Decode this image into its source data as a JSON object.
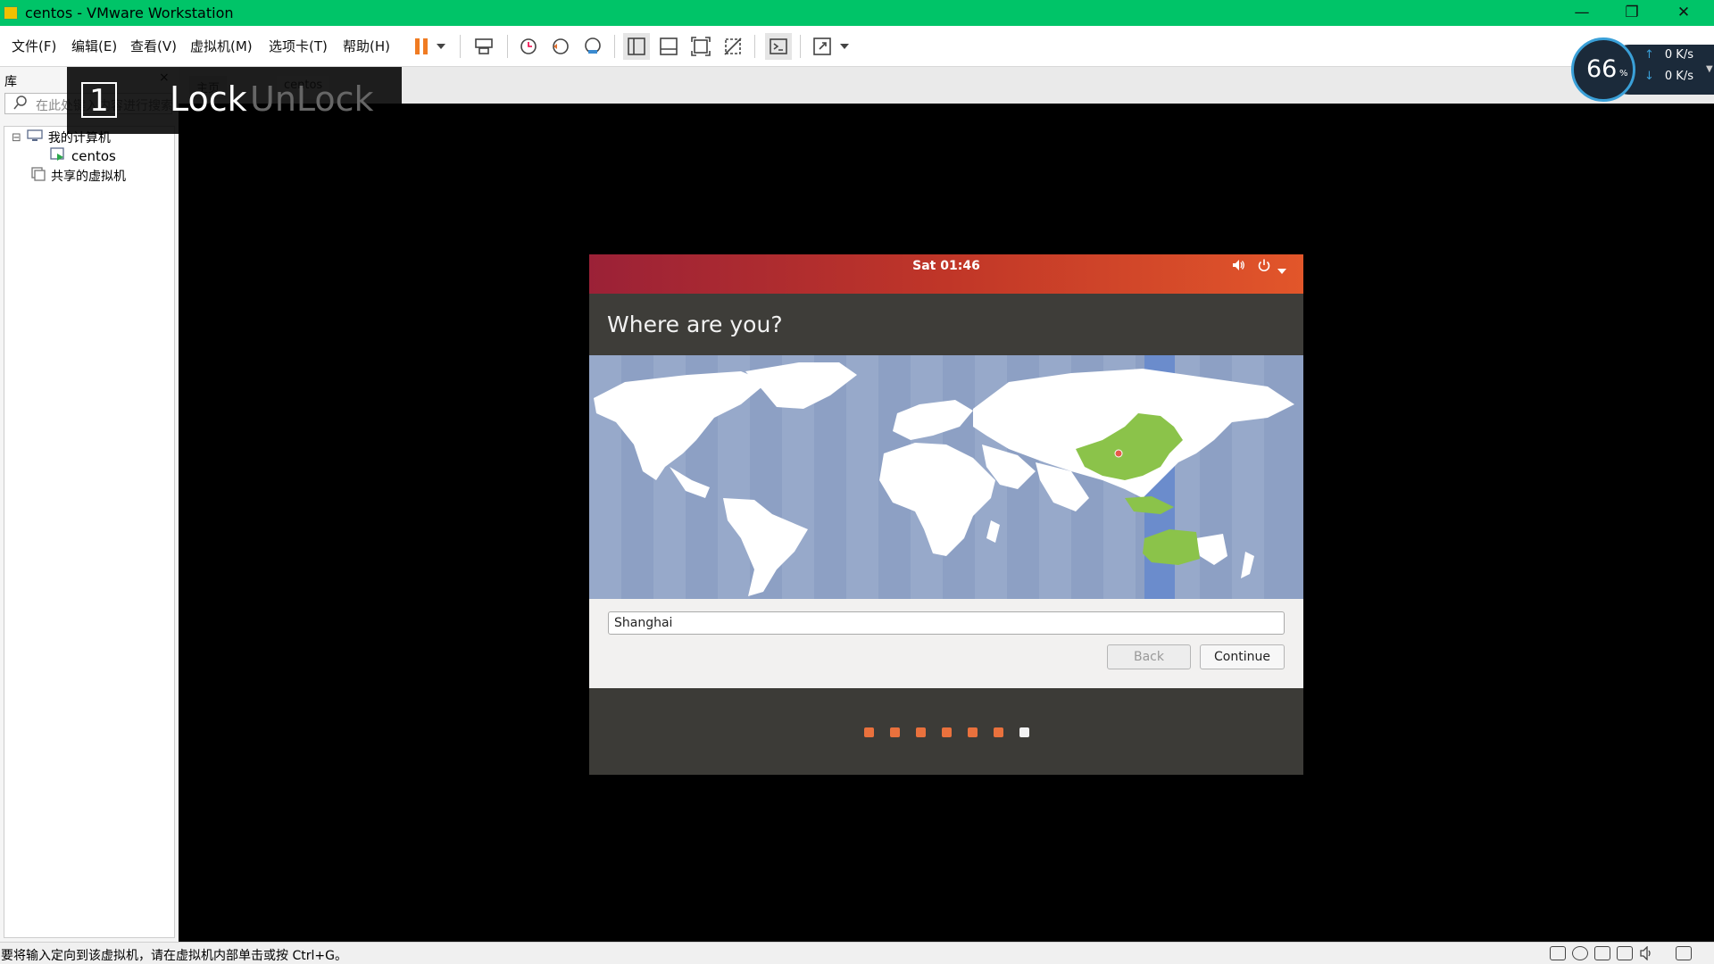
{
  "window": {
    "title": "centos - VMware Workstation",
    "minimize": "—",
    "restore": "❐",
    "close": "✕"
  },
  "menu": [
    "文件(F)",
    "编辑(E)",
    "查看(V)",
    "虚拟机(M)",
    "选项卡(T)",
    "帮助(H)"
  ],
  "library": {
    "title": "库",
    "close": "×",
    "search_placeholder": "在此处键入内容进行搜索",
    "tree": [
      {
        "label": "我的计算机",
        "expander": "⊟"
      },
      {
        "label": "centos"
      },
      {
        "label": "共享的虚拟机"
      }
    ]
  },
  "tabs": [
    "主页",
    "centos"
  ],
  "lock_overlay": {
    "number": "1",
    "lock": "Lock",
    "unlock": "UnLock"
  },
  "speed_widget": {
    "percent": "66",
    "percent_sign": "%",
    "upload": "0 K/s",
    "download": "0 K/s",
    "up_arrow": "↑",
    "down_arrow": "↓"
  },
  "installer": {
    "clock": "Sat 01:46",
    "question": "Where are you?",
    "timezone_value": "Shanghai",
    "back_label": "Back",
    "continue_label": "Continue",
    "progress_steps_total": 7,
    "progress_current_step": 7,
    "colors": {
      "dot_done": "#e9713d",
      "dot_current": "#f2f2f2",
      "highlight_land": "#8bc34a",
      "selected_tz_band": "#6b8ccc"
    }
  },
  "statusbar": {
    "message": "要将输入定向到该虚拟机，请在虚拟机内部单击或按 Ctrl+G。"
  }
}
